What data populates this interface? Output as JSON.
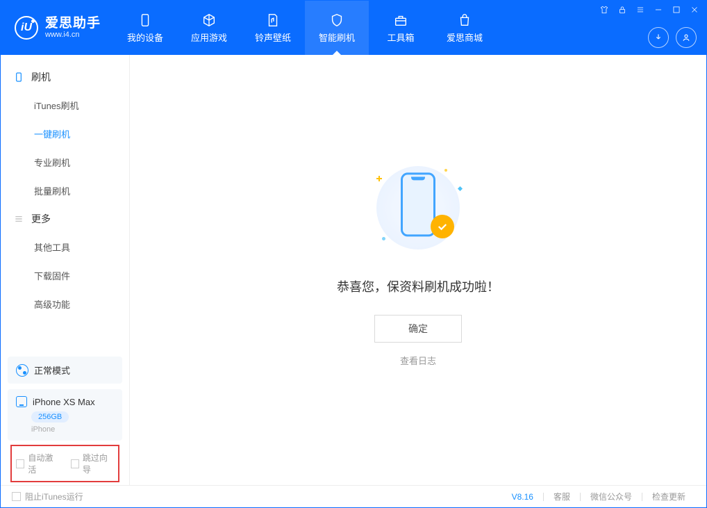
{
  "app": {
    "title": "爱思助手",
    "sub": "www.i4.cn"
  },
  "nav": {
    "tabs": [
      {
        "label": "我的设备"
      },
      {
        "label": "应用游戏"
      },
      {
        "label": "铃声壁纸"
      },
      {
        "label": "智能刷机"
      },
      {
        "label": "工具箱"
      },
      {
        "label": "爱思商城"
      }
    ]
  },
  "sidebar": {
    "group_flash": "刷机",
    "items_flash": [
      {
        "label": "iTunes刷机"
      },
      {
        "label": "一键刷机"
      },
      {
        "label": "专业刷机"
      },
      {
        "label": "批量刷机"
      }
    ],
    "group_more": "更多",
    "items_more": [
      {
        "label": "其他工具"
      },
      {
        "label": "下载固件"
      },
      {
        "label": "高级功能"
      }
    ],
    "status_mode": "正常模式",
    "device": {
      "name": "iPhone XS Max",
      "storage": "256GB",
      "type": "iPhone"
    },
    "cb_auto_activate": "自动激活",
    "cb_skip_guide": "跳过向导"
  },
  "main": {
    "success_text": "恭喜您，保资料刷机成功啦！",
    "confirm_btn": "确定",
    "view_log": "查看日志"
  },
  "footer": {
    "block_itunes": "阻止iTunes运行",
    "version": "V8.16",
    "links": [
      "客服",
      "微信公众号",
      "检查更新"
    ]
  }
}
